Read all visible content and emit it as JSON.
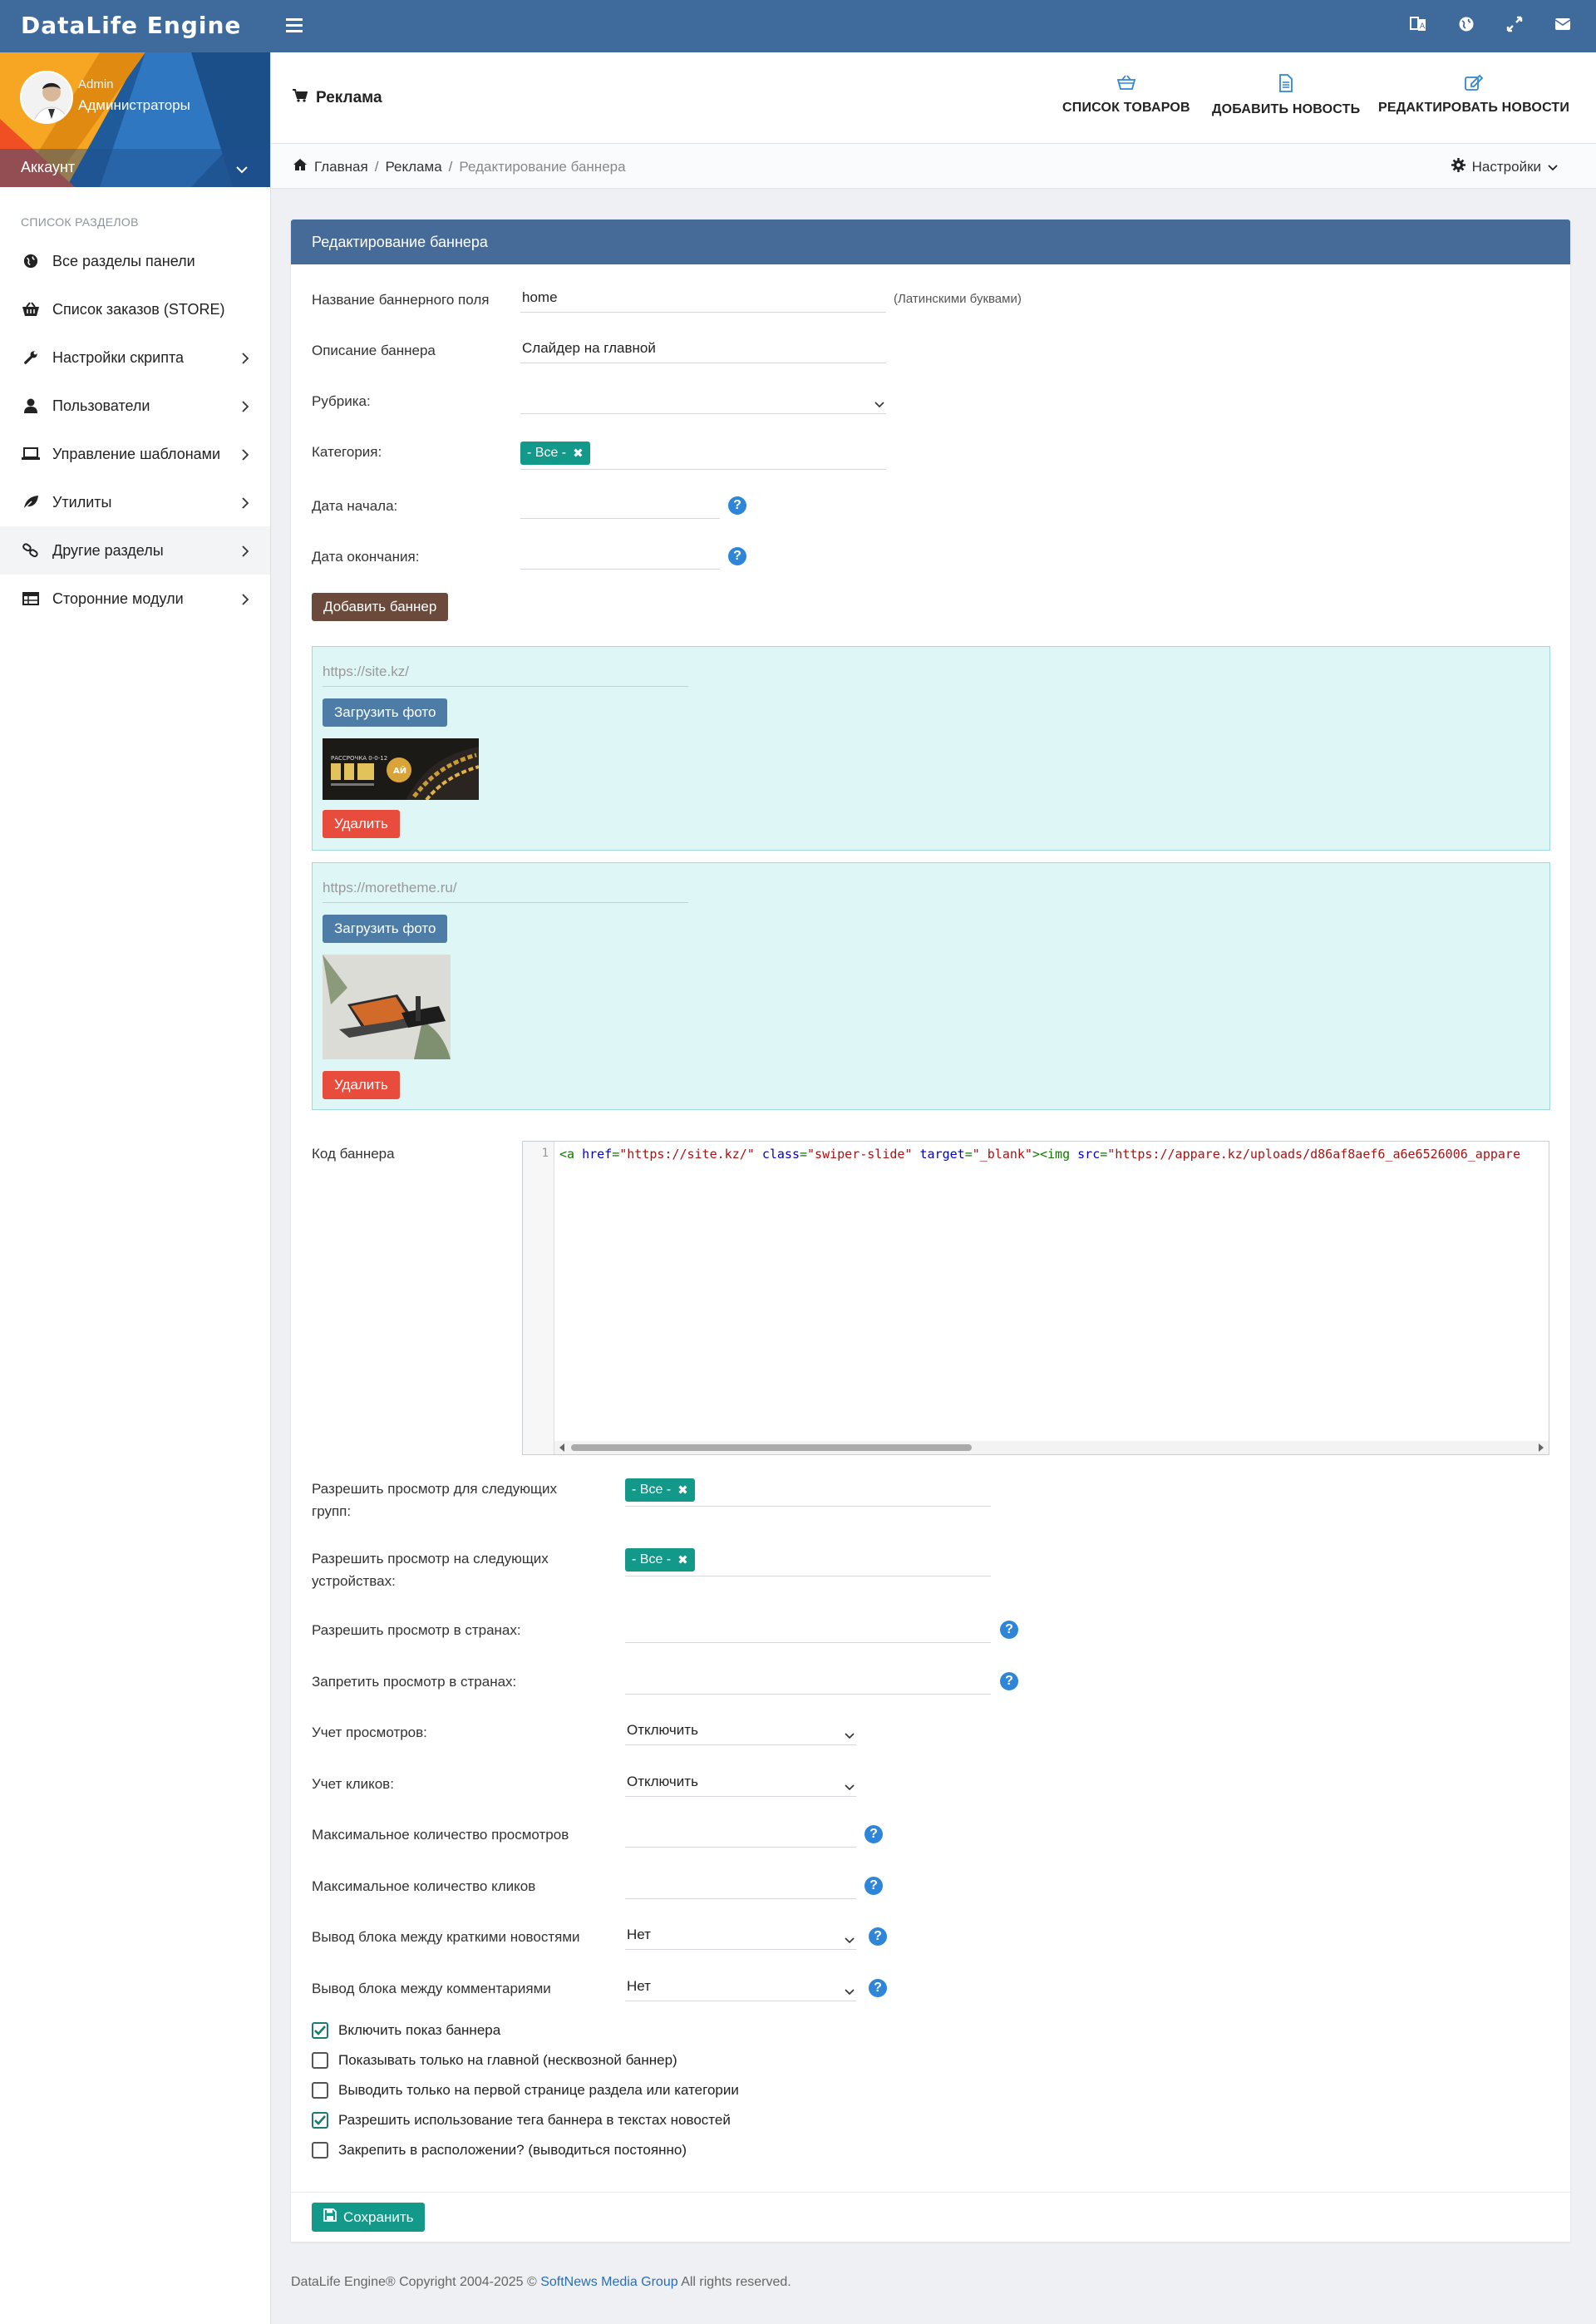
{
  "app": {
    "brand": "DataLife Engine"
  },
  "topbar": {
    "icons": [
      "translate-icon",
      "globe-icon",
      "fullscreen-icon",
      "mail-icon"
    ]
  },
  "user": {
    "name": "Admin",
    "role": "Администраторы",
    "account_label": "Аккаунт"
  },
  "sidebar": {
    "section_title": "СПИСОК РАЗДЕЛОВ",
    "items": [
      {
        "label": "Все разделы панели",
        "icon": "globe-icon",
        "arrow": false
      },
      {
        "label": "Список заказов (STORE)",
        "icon": "basket-icon",
        "arrow": false
      },
      {
        "label": "Настройки скрипта",
        "icon": "wrench-icon",
        "arrow": true
      },
      {
        "label": "Пользователи",
        "icon": "user-icon",
        "arrow": true
      },
      {
        "label": "Управление шаблонами",
        "icon": "laptop-icon",
        "arrow": true
      },
      {
        "label": "Утилиты",
        "icon": "leaf-icon",
        "arrow": true
      },
      {
        "label": "Другие разделы",
        "icon": "link-icon",
        "arrow": true
      },
      {
        "label": "Сторонние модули",
        "icon": "table-icon",
        "arrow": true
      }
    ]
  },
  "header": {
    "page_title": "Реклама",
    "actions": [
      {
        "label": "СПИСОК ТОВАРОВ",
        "icon": "basket-icon"
      },
      {
        "label": "ДОБАВИТЬ НОВОСТЬ",
        "icon": "document-icon"
      },
      {
        "label": "РЕДАКТИРОВАТЬ НОВОСТИ",
        "icon": "edit-icon"
      }
    ]
  },
  "breadcrumb": {
    "home": "Главная",
    "section": "Реклама",
    "current": "Редактирование баннера",
    "settings": "Настройки"
  },
  "form": {
    "title": "Редактирование баннера",
    "name_label": "Название баннерного поля",
    "name_value": "home",
    "name_hint": "(Латинскими буквами)",
    "desc_label": "Описание баннера",
    "desc_value": "Слайдер на главной",
    "rubric_label": "Рубрика:",
    "rubric_value": "",
    "category_label": "Категория:",
    "category_tag": "- Все -",
    "start_label": "Дата начала:",
    "end_label": "Дата окончания:",
    "add_banner": "Добавить баннер",
    "banners": [
      {
        "url": "https://site.kz/",
        "upload": "Загрузить фото",
        "delete": "Удалить",
        "image_text": "РАССРОЧКА 0-0-12"
      },
      {
        "url": "https://moretheme.ru/",
        "upload": "Загрузить фото",
        "delete": "Удалить"
      }
    ],
    "code_label": "Код баннера",
    "code_line_number": "1",
    "code_parts": [
      "<a ",
      "href",
      "=",
      "\"https://site.kz/\"",
      " ",
      "class",
      "=",
      "\"swiper-slide\"",
      " ",
      "target",
      "=",
      "\"_blank\"",
      "><img ",
      "src",
      "=",
      "\"https://appare.kz/uploads/d86af8aef6_a6e6526006_appare"
    ],
    "groups_label": "Разрешить просмотр для следующих групп:",
    "groups_tag": "- Все -",
    "devices_label": "Разрешить просмотр на следующих устройствах:",
    "devices_tag": "- Все -",
    "allow_countries_label": "Разрешить просмотр в странах:",
    "deny_countries_label": "Запретить просмотр в странах:",
    "views_count_label": "Учет просмотров:",
    "views_count_value": "Отключить",
    "clicks_count_label": "Учет кликов:",
    "clicks_count_value": "Отключить",
    "max_views_label": "Максимальное количество просмотров",
    "max_clicks_label": "Максимальное количество кликов",
    "between_news_label": "Вывод блока между краткими новостями",
    "between_news_value": "Нет",
    "between_comments_label": "Вывод блока между комментариями",
    "between_comments_value": "Нет",
    "checkboxes": [
      {
        "label": "Включить показ баннера",
        "checked": true
      },
      {
        "label": "Показывать только на главной (несквозной баннер)",
        "checked": false
      },
      {
        "label": "Выводить только на первой странице раздела или категории",
        "checked": false
      },
      {
        "label": "Разрешить использование тега баннера в текстах новостей",
        "checked": true
      },
      {
        "label": "Закрепить в расположении? (выводиться постоянно)",
        "checked": false
      }
    ],
    "save": "Сохранить"
  },
  "footer": {
    "copyright": "DataLife Engine® Copyright 2004-2025 © ",
    "company": "SoftNews Media Group",
    "rights": " All rights reserved."
  },
  "colors": {
    "topbar": "#3e6a9c",
    "panel_header": "#466b98",
    "teal": "#13998a",
    "danger": "#e74c3c",
    "upload": "#4d7ca7",
    "add": "#6b4a3b",
    "banner_bg": "#dff6f7"
  }
}
